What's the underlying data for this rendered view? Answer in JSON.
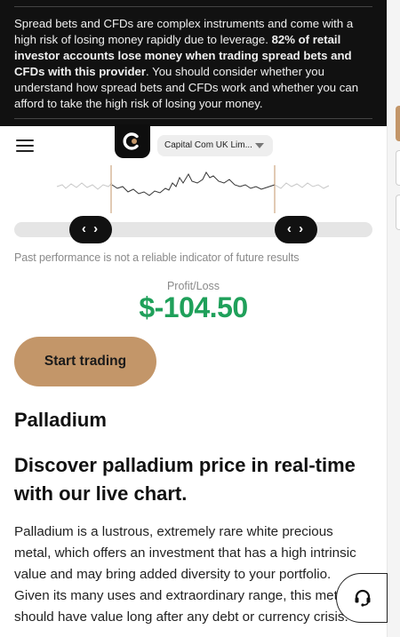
{
  "risk_warning": {
    "part1": "Spread bets and CFDs are complex instruments and come with a high risk of losing money rapidly due to leverage.",
    "bold": "82% of retail investor accounts lose money when trading spread bets and CFDs with this provider",
    "part2": ". You should consider whether you understand how spread bets and CFDs work and whether you can afford to take the high risk of losing your money."
  },
  "header": {
    "menu_icon": "hamburger-icon",
    "logo_icon": "capital-com-logo",
    "entity_selector": "Capital Com UK Lim..."
  },
  "slider": {
    "left_handle": "‹ ›",
    "right_handle": "‹ ›"
  },
  "disclaimer": "Past performance is not a reliable indicator of future results",
  "profit_loss": {
    "label": "Profit/Loss",
    "value": "$-104.50",
    "color": "#1fa05a"
  },
  "cta": {
    "label": "Start trading",
    "color": "#c39669"
  },
  "content": {
    "asset_title": "Palladium",
    "subtitle": "Discover palladium price in real-time with our live chart.",
    "paragraph": "Palladium is a lustrous, extremely rare white precious metal, which offers an investment that has a high intrinsic value and may bring added diversity to your portfolio. Given its many uses and extraordinary range, this metal should have value long after any debt or currency crisis."
  },
  "support": {
    "icon": "headset-icon"
  }
}
